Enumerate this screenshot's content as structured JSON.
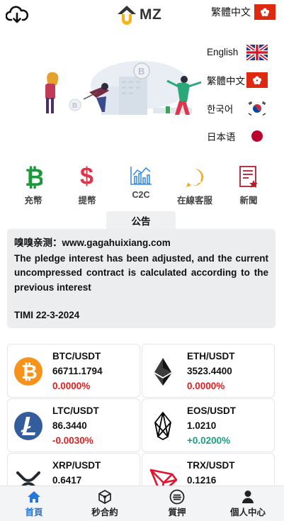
{
  "header": {
    "logo_text": "MZ",
    "current_language": "繁體中文"
  },
  "languages": [
    {
      "label": "English",
      "flag": "uk"
    },
    {
      "label": "繁體中文",
      "flag": "hk"
    },
    {
      "label": "한국어",
      "flag": "kr"
    },
    {
      "label": "日本语",
      "flag": "jp"
    }
  ],
  "quick_actions": [
    {
      "label": "充幣",
      "icon": "bitcoin-icon",
      "color": "#1a9a3a"
    },
    {
      "label": "提幣",
      "icon": "dollar-icon",
      "color": "#e0344a"
    },
    {
      "label": "C2C",
      "icon": "chart-icon",
      "color": "#3a8fe0"
    },
    {
      "label": "在線客服",
      "icon": "whatsapp-icon",
      "color": "#f2a51c"
    },
    {
      "label": "新聞",
      "icon": "news-icon",
      "color": "#b01e2e"
    }
  ],
  "notice": {
    "tab_label": "公告",
    "line1": "嗅嗅亲测：www.gagahuixiang.com",
    "body": "The pledge interest has been adjusted, and the current uncompressed contract is calculated according to the previous interest",
    "signature": "TIMI 22-3-2024"
  },
  "markets": [
    {
      "pair": "BTC/USDT",
      "price": "66711.1794",
      "change": "0.0000%",
      "icon": "btc-icon",
      "change_color": "#e11d1d"
    },
    {
      "pair": "ETH/USDT",
      "price": "3523.4400",
      "change": "0.0000%",
      "icon": "eth-icon",
      "change_color": "#e11d1d"
    },
    {
      "pair": "LTC/USDT",
      "price": "86.3440",
      "change": "-0.0030%",
      "icon": "ltc-icon",
      "change_color": "#e11d1d"
    },
    {
      "pair": "EOS/USDT",
      "price": "1.0210",
      "change": "+0.0200%",
      "icon": "eos-icon",
      "change_color": "#16a085"
    },
    {
      "pair": "XRP/USDT",
      "price": "0.6417",
      "change": "",
      "icon": "xrp-icon",
      "change_color": "#e11d1d"
    },
    {
      "pair": "TRX/USDT",
      "price": "0.1216",
      "change": "",
      "icon": "trx-icon",
      "change_color": "#e11d1d"
    }
  ],
  "tabbar": [
    {
      "label": "首頁",
      "icon": "home-icon",
      "active": true
    },
    {
      "label": "秒合約",
      "icon": "cube-icon",
      "active": false
    },
    {
      "label": "質押",
      "icon": "coin-stack-icon",
      "active": false
    },
    {
      "label": "個人中心",
      "icon": "user-icon",
      "active": false
    }
  ],
  "colors": {
    "accent": "#2776d8",
    "up": "#16a085",
    "down": "#e11d1d"
  }
}
